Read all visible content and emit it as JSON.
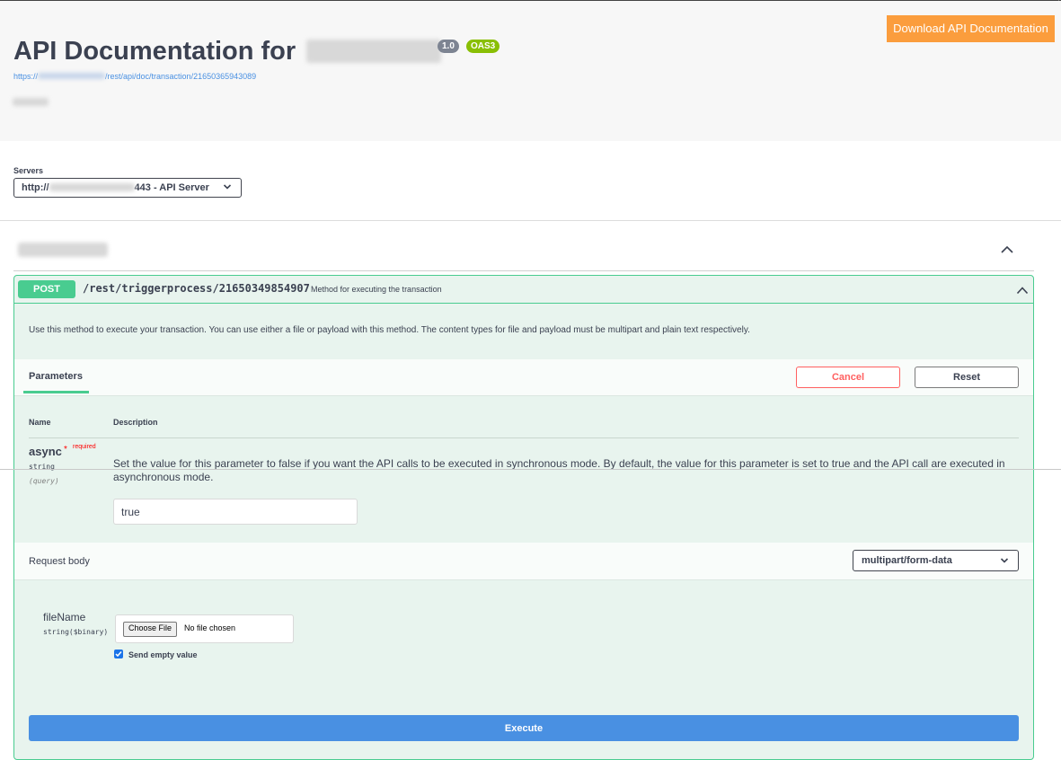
{
  "info": {
    "title_prefix": "API Documentation for",
    "version_badge": "1.0",
    "oas_badge": "OAS3",
    "url_prefix": "https://",
    "url_suffix": "/rest/api/doc/transaction/21650365943089",
    "download_button": "Download API Documentation"
  },
  "servers": {
    "label": "Servers",
    "selected_prefix": "http://",
    "selected_suffix": "443 - API Server"
  },
  "operation": {
    "method": "POST",
    "path": "/rest/triggerprocess/21650349854907",
    "summary": "Method for executing the transaction",
    "description": "Use this method to execute your transaction. You can use either a file or payload with this method. The content types for file and payload must be multipart and plain text respectively."
  },
  "parameters": {
    "tab_label": "Parameters",
    "cancel_button": "Cancel",
    "reset_button": "Reset",
    "columns": [
      "Name",
      "Description"
    ],
    "items": [
      {
        "name": "async",
        "required_star": "*",
        "required_label": "required",
        "type": "string",
        "in": "(query)",
        "description": "Set the value for this parameter to false if you want the API calls to be executed in synchronous mode. By default, the value for this parameter is set to true and the API call are executed in asynchronous mode.",
        "value": "true"
      }
    ]
  },
  "request_body": {
    "label": "Request body",
    "content_type": "multipart/form-data",
    "field_name": "fileName",
    "field_type": "string($binary)",
    "choose_file_label": "Choose File",
    "no_file_label": "No file chosen",
    "send_empty_label": "Send empty value",
    "send_empty_checked": true
  },
  "execute_button": "Execute",
  "colors": {
    "post": "#49cc90",
    "execute": "#4990e2",
    "download": "#fb9d3d",
    "cancel": "#ff6060",
    "version_badge": "#7d8492",
    "oas_badge": "#89bf04"
  }
}
